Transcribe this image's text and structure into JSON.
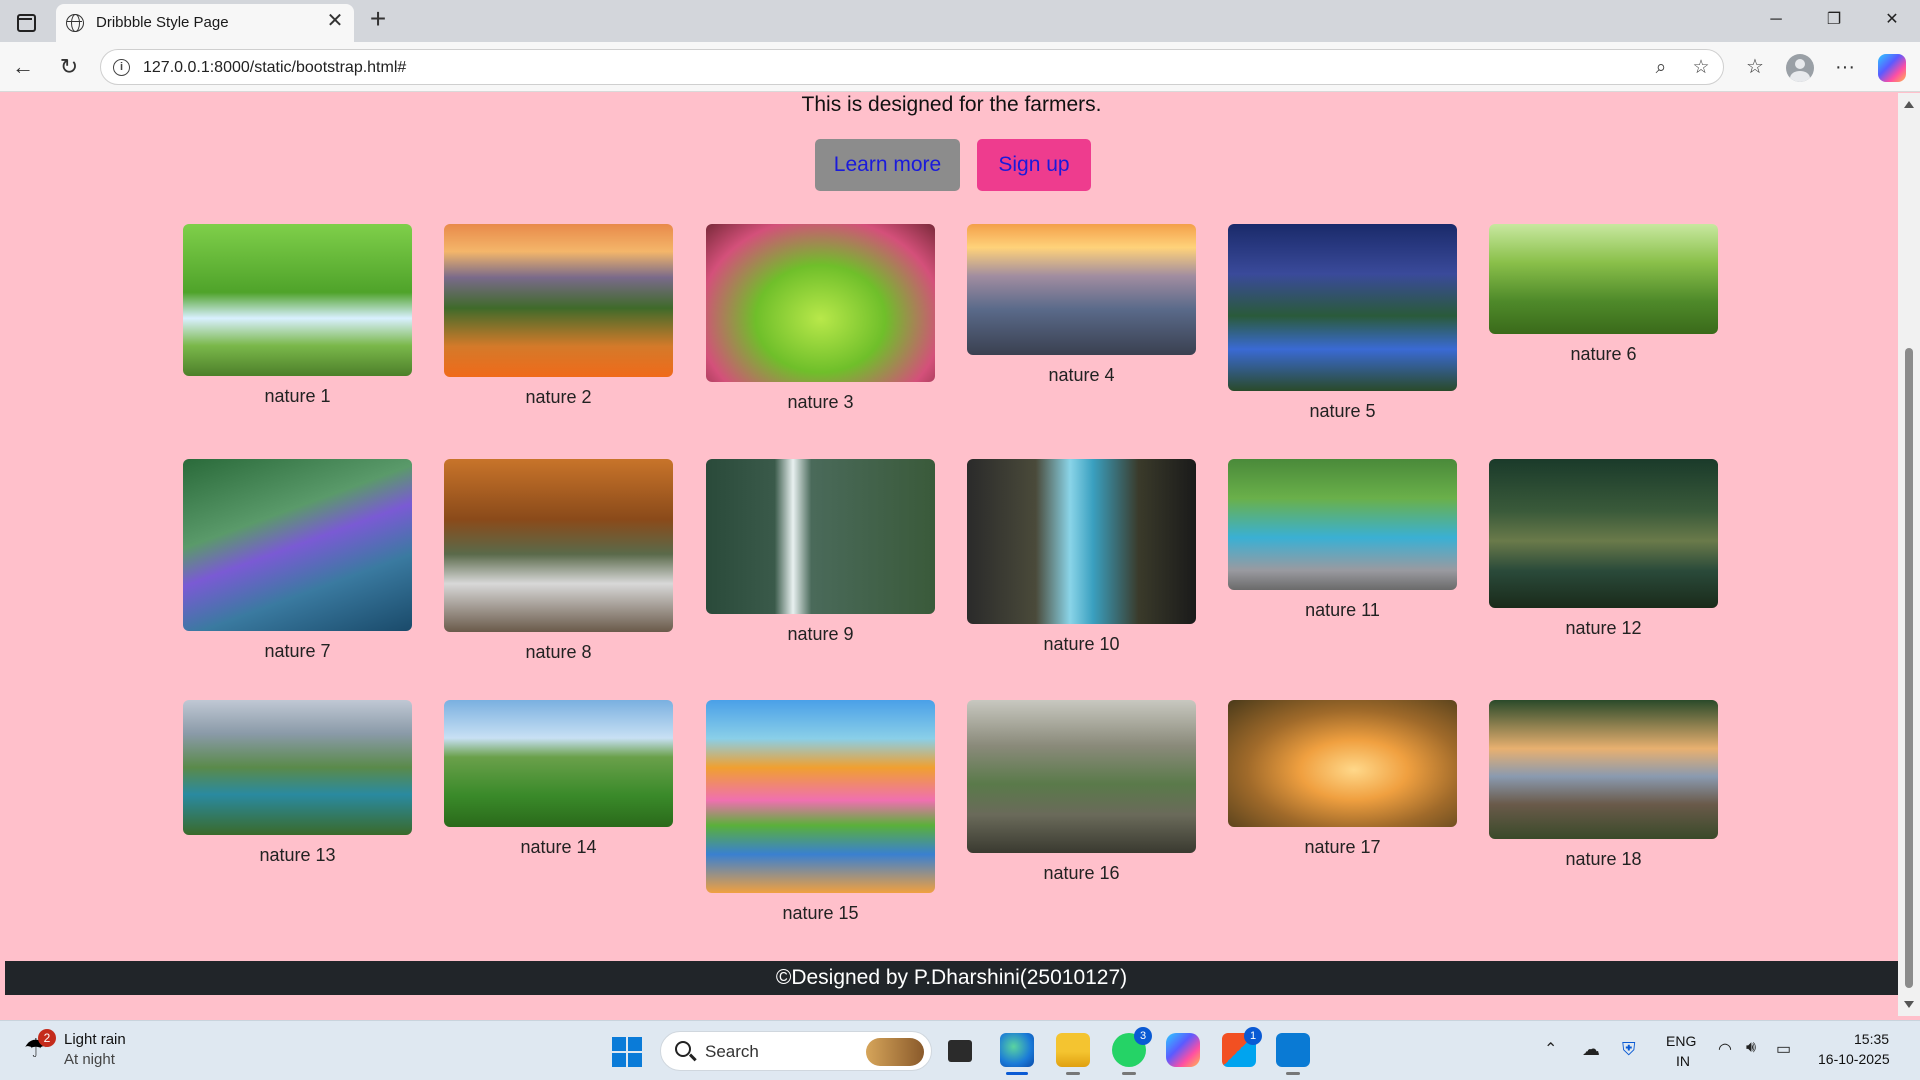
{
  "browser": {
    "tab_title": "Dribbble Style Page",
    "url": "127.0.0.1:8000/static/bootstrap.html#"
  },
  "page": {
    "intro": "This is designed for the farmers.",
    "learn_more_label": "Learn more",
    "signup_label": "Sign up",
    "footer": "©Designed by P.Dharshini(25010127)",
    "bg_color": "#ffc0cb",
    "learn_more_color": "#8c8c8c",
    "signup_color": "#ee3c8e"
  },
  "gallery": [
    {
      "caption": "nature 1",
      "scene": "forest-waterfall"
    },
    {
      "caption": "nature 2",
      "scene": "sunset-meadow-flowers"
    },
    {
      "caption": "nature 3",
      "scene": "pink-blossom-branches"
    },
    {
      "caption": "nature 4",
      "scene": "mountain-sunrise"
    },
    {
      "caption": "nature 5",
      "scene": "night-forest-river"
    },
    {
      "caption": "nature 6",
      "scene": "tea-plantation-hills"
    },
    {
      "caption": "nature 7",
      "scene": "butterfly-purple-flowers"
    },
    {
      "caption": "nature 8",
      "scene": "autumn-waterfall"
    },
    {
      "caption": "nature 9",
      "scene": "tall-waterfall-cliff"
    },
    {
      "caption": "nature 10",
      "scene": "rocky-waterfall"
    },
    {
      "caption": "nature 11",
      "scene": "mountain-stream"
    },
    {
      "caption": "nature 12",
      "scene": "lone-tree-lake"
    },
    {
      "caption": "nature 13",
      "scene": "lakes-waterfalls-valley"
    },
    {
      "caption": "nature 14",
      "scene": "green-field-tractor"
    },
    {
      "caption": "nature 15",
      "scene": "colorful-trees-lake"
    },
    {
      "caption": "nature 16",
      "scene": "valley-river-rocks"
    },
    {
      "caption": "nature 17",
      "scene": "sprout-sunset"
    },
    {
      "caption": "nature 18",
      "scene": "forest-lake-sunset"
    }
  ],
  "taskbar": {
    "weather_badge": "2",
    "weather_line1": "Light rain",
    "weather_line2": "At night",
    "search_placeholder": "Search",
    "whatsapp_badge": "3",
    "store_badge": "1",
    "lang_line1": "ENG",
    "lang_line2": "IN",
    "time": "15:35",
    "date": "16-10-2025"
  }
}
